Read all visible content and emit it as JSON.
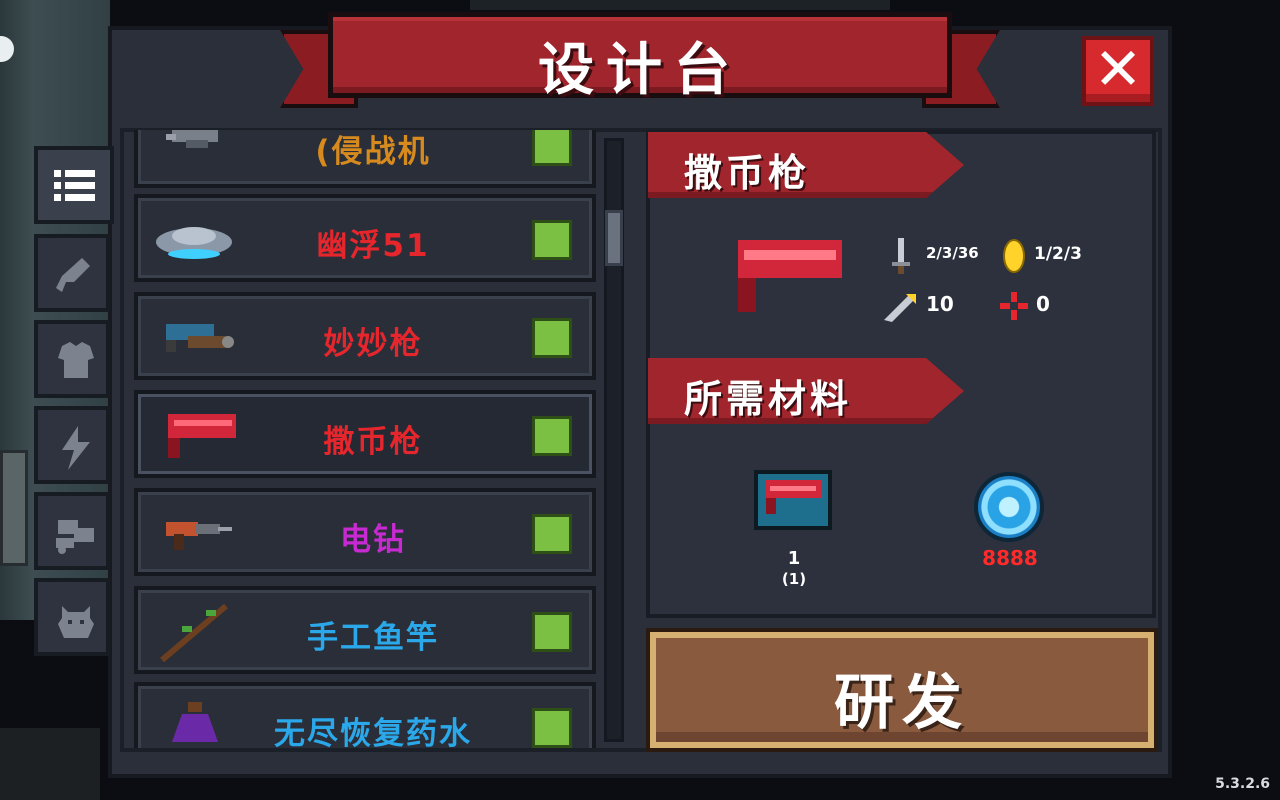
{
  "title": "设计台",
  "close_label": "✕",
  "side_tabs": [
    "list-icon",
    "gun-icon",
    "armor-icon",
    "lightning-icon",
    "vehicle-icon",
    "pet-icon"
  ],
  "list": {
    "items": [
      {
        "name": "(侵战机",
        "color": "#d78a1e",
        "icon": "fighter-jet-icon"
      },
      {
        "name": "幽浮51",
        "color": "#e5262c",
        "icon": "ufo-icon"
      },
      {
        "name": "妙妙枪",
        "color": "#e5262c",
        "icon": "cat-gun-icon"
      },
      {
        "name": "撒币枪",
        "color": "#e5262c",
        "icon": "coin-gun-icon"
      },
      {
        "name": "电钻",
        "color": "#c62ad0",
        "icon": "drill-icon"
      },
      {
        "name": "手工鱼竿",
        "color": "#2aa8ea",
        "icon": "fishing-rod-icon"
      },
      {
        "name": "无尽恢复药水",
        "color": "#2aa8ea",
        "icon": "potion-icon"
      }
    ]
  },
  "detail": {
    "weapon_title": "撒币枪",
    "damage": "2/3/36",
    "energy": "1/2/3",
    "crit": "10",
    "spread": "0",
    "materials_title": "所需材料",
    "material_count": "1",
    "material_have": "(1)",
    "material_cost": "8888"
  },
  "research_label": "研发",
  "version": "5.3.2.6"
}
